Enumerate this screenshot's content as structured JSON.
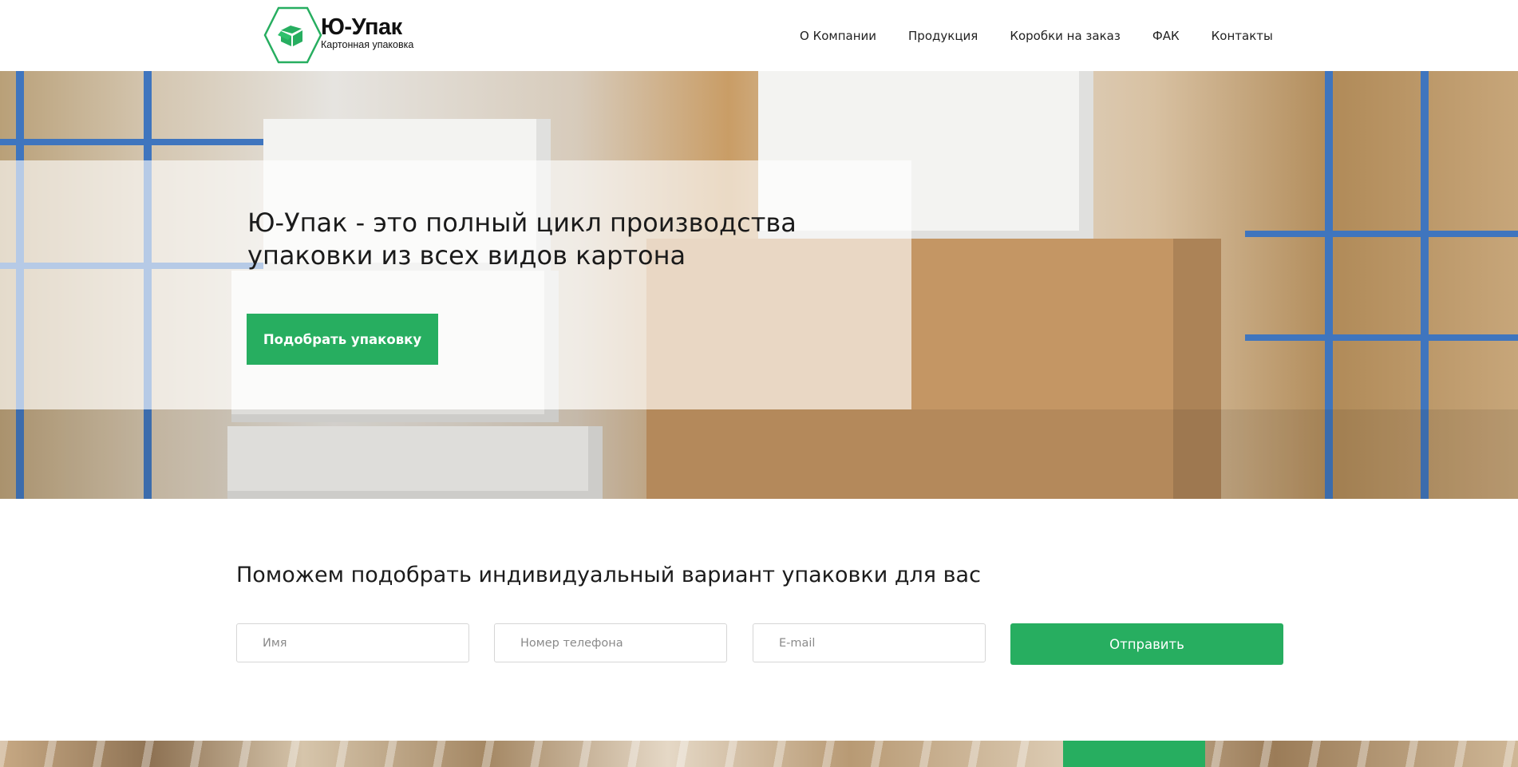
{
  "logo": {
    "name": "Ю-Упак",
    "subtitle": "Картонная упаковка"
  },
  "nav": [
    "О Компании",
    "Продукция",
    "Коробки на заказ",
    "ФАК",
    "Контакты"
  ],
  "hero": {
    "title": "Ю-Упак - это полный цикл производства упаковки из всех видов картона",
    "button": "Подобрать упаковку"
  },
  "form": {
    "title": "Поможем подобрать индивидуальный вариант упаковки для вас",
    "name_placeholder": "Имя",
    "phone_placeholder": "Номер телефона",
    "email_placeholder": "E-mail",
    "submit": "Отправить"
  },
  "colors": {
    "accent": "#27ae60"
  }
}
